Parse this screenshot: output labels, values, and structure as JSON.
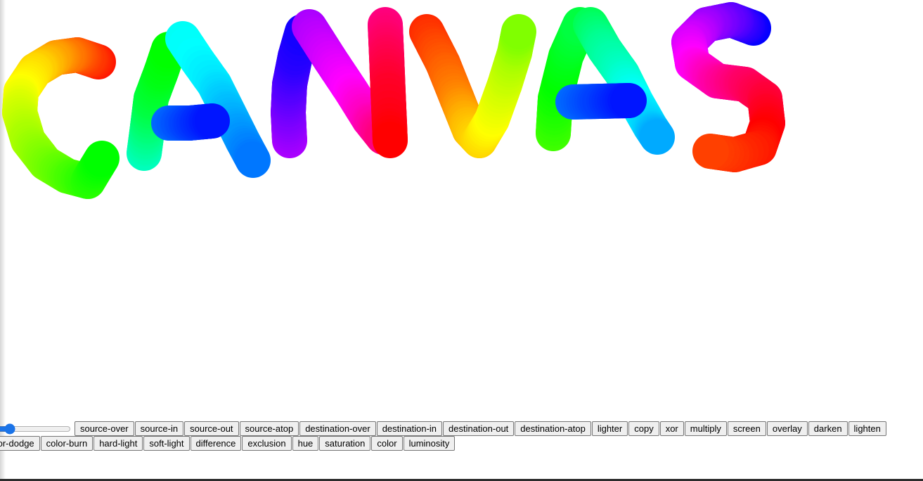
{
  "canvas": {
    "drawn_text": "CANVAS"
  },
  "brush_slider": {
    "value": 30
  },
  "composite_modes": {
    "row1": [
      "source-over",
      "source-in",
      "source-out",
      "source-atop",
      "destination-over",
      "destination-in",
      "destination-out",
      "destination-atop",
      "lighter",
      "copy",
      "xor",
      "multiply",
      "screen",
      "overlay",
      "darken",
      "lighten"
    ],
    "row2": [
      "color-dodge",
      "color-burn",
      "hard-light",
      "soft-light",
      "difference",
      "exclusion",
      "hue",
      "saturation",
      "color",
      "luminosity"
    ]
  }
}
